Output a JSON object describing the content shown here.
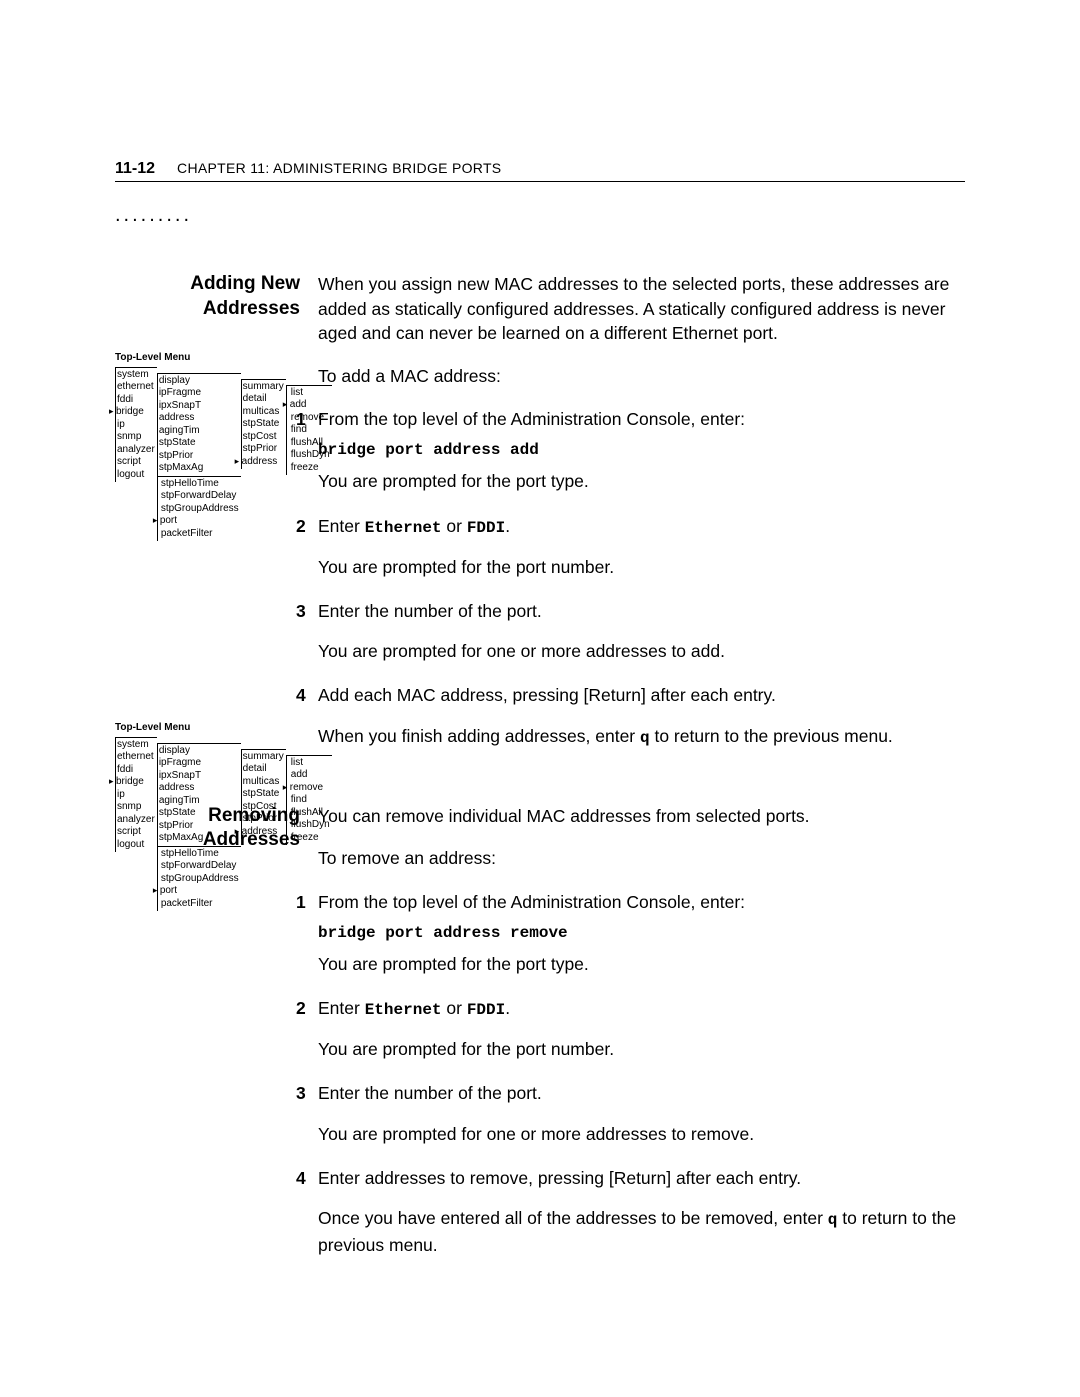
{
  "header": {
    "page_num": "11-12",
    "chapter": "CHAPTER 11: ADMINISTERING BRIDGE PORTS",
    "dots": "........."
  },
  "section1": {
    "heading_l1": "Adding New",
    "heading_l2": "Addresses",
    "intro": "When you assign new MAC addresses to the selected ports, these addresses are added as statically configured addresses. A statically configured address is never aged and can never be learned on a different Ethernet port.",
    "lead": "To add a MAC address:",
    "step1a": "From the top level of the Administration Console, enter:",
    "step1cmd": "bridge port address add",
    "step1b": "You are prompted for the port type.",
    "step2_pre": "Enter ",
    "step2_eth": "Ethernet",
    "step2_or": " or ",
    "step2_fddi": "FDDI",
    "step2_post": ".",
    "step2b": "You are prompted for the port number.",
    "step3a": "Enter the number of the port.",
    "step3b": "You are prompted for one or more addresses to add.",
    "step4a": "Add each MAC address, pressing [Return] after each entry.",
    "step4b_pre": "When you finish adding addresses, enter ",
    "step4b_q": "q",
    "step4b_post": " to return to the previous menu."
  },
  "section2": {
    "heading_l1": "Removing",
    "heading_l2": "Addresses",
    "intro": "You can remove individual MAC addresses from selected ports.",
    "lead": "To remove an address:",
    "step1a": "From the top level of the Administration Console, enter:",
    "step1cmd": "bridge port address remove",
    "step1b": "You are prompted for the port type.",
    "step2_pre": "Enter ",
    "step2_eth": "Ethernet",
    "step2_or": " or ",
    "step2_fddi": "FDDI",
    "step2_post": ".",
    "step2b": "You are prompted for the port number.",
    "step3a": "Enter the number of the port.",
    "step3b": "You are prompted for one or more addresses to remove.",
    "step4a": "Enter addresses to remove, pressing [Return] after each entry.",
    "step4b_pre": "Once you have entered all of the addresses to be removed, enter ",
    "step4b_q": "q",
    "step4b_post": " to return to the previous menu."
  },
  "menu": {
    "title": "Top-Level Menu",
    "col1": [
      "system",
      "ethernet",
      "fddi",
      "bridge",
      "ip",
      "snmp",
      "analyzer",
      "script",
      "logout"
    ],
    "col1_marker": "bridge",
    "col2": [
      "display",
      "ipFragmentation",
      "ipxSnapTranslation",
      "address",
      "agingTime",
      "stpState",
      "stpPriority",
      "stpMaxAge",
      "stpHelloTime",
      "stpForwardDelay",
      "stpGroupAddress",
      "port",
      "packetFilter"
    ],
    "col2_marker": "port",
    "col3": [
      "summary",
      "detail",
      "multicast",
      "stpState",
      "stpCost",
      "stpPriority",
      "address"
    ],
    "col3_marker": "address",
    "col4_add": [
      "list",
      "add",
      "remove",
      "find",
      "flushAll",
      "flushDynamic",
      "freeze"
    ],
    "col4_add_marker": "add",
    "col4_remove": [
      "list",
      "add",
      "remove",
      "find",
      "flushAll",
      "flushDynamic",
      "freeze"
    ],
    "col4_remove_marker": "remove"
  }
}
